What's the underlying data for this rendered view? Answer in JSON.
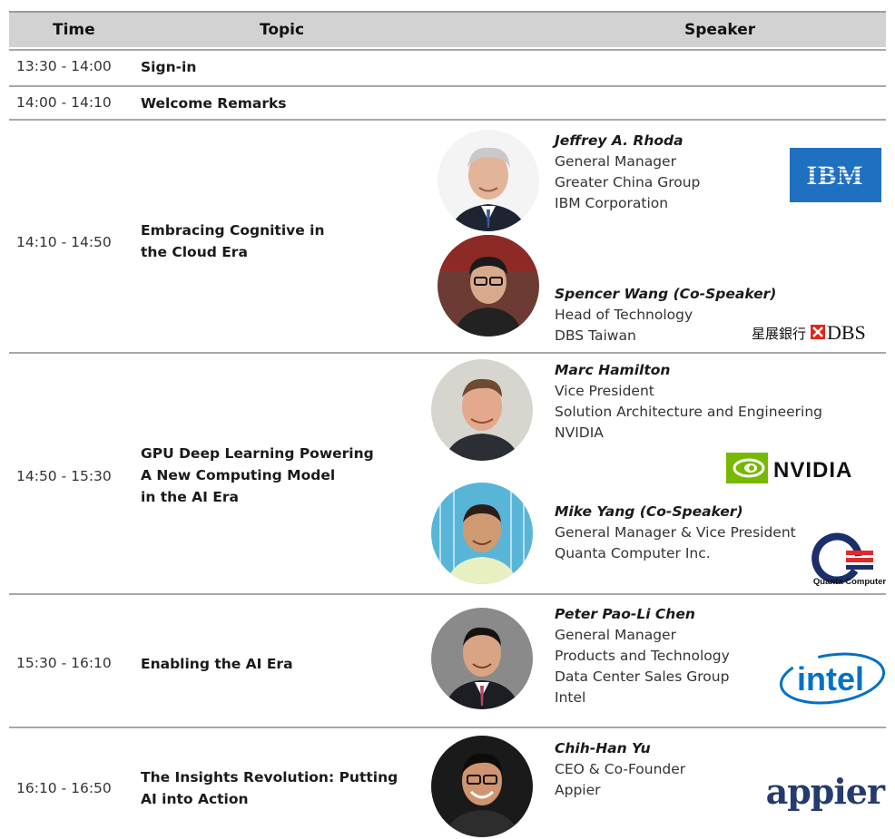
{
  "header": {
    "time": "Time",
    "topic": "Topic",
    "speaker": "Speaker"
  },
  "rows": [
    {
      "time": "13:30 - 14:00",
      "topic": "Sign-in"
    },
    {
      "time": "14:00 - 14:10",
      "topic": "Welcome Remarks"
    },
    {
      "time": "14:10 - 14:50",
      "topic": [
        "Embracing Cognitive in",
        "the Cloud Era"
      ],
      "speakers": [
        {
          "name": "Jeffrey A. Rhoda",
          "lines": [
            "General Manager",
            "Greater China Group",
            "IBM Corporation"
          ],
          "logo": "IBM"
        },
        {
          "name": "Spencer Wang (Co-Speaker)",
          "lines": [
            "Head of Technology",
            "DBS Taiwan"
          ],
          "logo": "星展銀行 DBS"
        }
      ]
    },
    {
      "time": "14:50 - 15:30",
      "topic": [
        "GPU Deep Learning Powering",
        "A New Computing Model",
        "in the AI Era"
      ],
      "speakers": [
        {
          "name": "Marc Hamilton",
          "lines": [
            "Vice President",
            "Solution Architecture and Engineering",
            "NVIDIA"
          ],
          "logo": "NVIDIA"
        },
        {
          "name": "Mike Yang (Co-Speaker)",
          "lines": [
            "General Manager & Vice President",
            "Quanta Computer Inc."
          ],
          "logo": "Quanta Computer"
        }
      ]
    },
    {
      "time": "15:30 - 16:10",
      "topic": [
        "Enabling the AI Era"
      ],
      "speakers": [
        {
          "name": "Peter Pao-Li Chen",
          "lines": [
            "General Manager",
            "Products and Technology",
            "Data Center Sales Group",
            "Intel"
          ],
          "logo": "intel"
        }
      ]
    },
    {
      "time": "16:10 - 16:50",
      "topic": [
        "The Insights Revolution: Putting",
        "AI into Action"
      ],
      "speakers": [
        {
          "name": "Chih-Han Yu",
          "lines": [
            "CEO & Co-Founder",
            "Appier"
          ],
          "logo": "appier"
        }
      ]
    }
  ],
  "colors": {
    "header_bg": "#d2d2d2",
    "ibm_blue": "#1f70c1",
    "nvidia_green": "#76b900",
    "dbs_red": "#e1251b",
    "quanta_navy": "#1b2f6b",
    "intel_blue": "#0071c5",
    "appier_navy": "#243b6e"
  }
}
